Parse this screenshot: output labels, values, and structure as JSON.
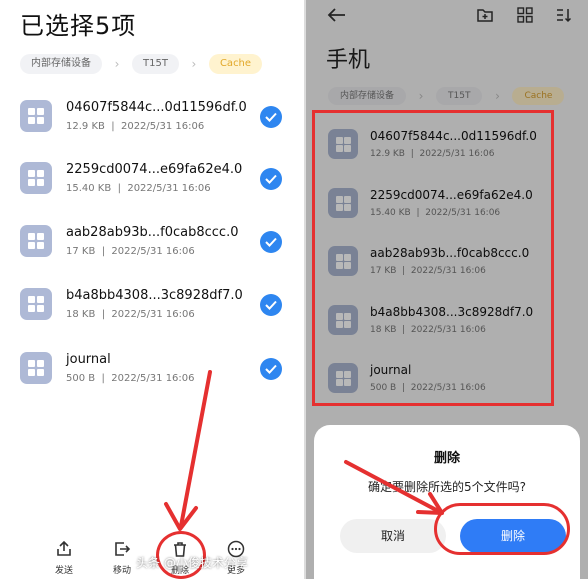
{
  "left": {
    "title": "已选择5项",
    "breadcrumbs": [
      "内部存储设备",
      "T15T",
      "Cache"
    ],
    "files": [
      {
        "name": "04607f5844c...0d11596df.0",
        "size": "12.9 KB",
        "date": "2022/5/31 16:06"
      },
      {
        "name": "2259cd0074...e69fa62e4.0",
        "size": "15.40 KB",
        "date": "2022/5/31 16:06"
      },
      {
        "name": "aab28ab93b...f0cab8ccc.0",
        "size": "17 KB",
        "date": "2022/5/31 16:06"
      },
      {
        "name": "b4a8bb4308...3c8928df7.0",
        "size": "18 KB",
        "date": "2022/5/31 16:06"
      },
      {
        "name": "journal",
        "size": "500 B",
        "date": "2022/5/31 16:06"
      }
    ],
    "actions": [
      "发送",
      "移动",
      "删除",
      "更多"
    ],
    "meta_separator": "|"
  },
  "right": {
    "title": "手机",
    "breadcrumbs": [
      "内部存储设备",
      "T15T",
      "Cache"
    ],
    "files": [
      {
        "name": "04607f5844c...0d11596df.0",
        "size": "12.9 KB",
        "date": "2022/5/31 16:06"
      },
      {
        "name": "2259cd0074...e69fa62e4.0",
        "size": "15.40 KB",
        "date": "2022/5/31 16:06"
      },
      {
        "name": "aab28ab93b...f0cab8ccc.0",
        "size": "17 KB",
        "date": "2022/5/31 16:06"
      },
      {
        "name": "b4a8bb4308...3c8928df7.0",
        "size": "18 KB",
        "date": "2022/5/31 16:06"
      },
      {
        "name": "journal",
        "size": "500 B",
        "date": "2022/5/31 16:06"
      }
    ],
    "toolbar_icons": [
      "back-arrow-icon",
      "new-folder-icon",
      "grid-view-icon",
      "sort-icon"
    ],
    "dialog": {
      "title": "删除",
      "message": "确定要删除所选的5个文件吗?",
      "cancel_label": "取消",
      "confirm_label": "删除"
    }
  },
  "watermark": "头条 @小俊技术分享",
  "colors": {
    "accent_blue": "#2e86f0",
    "annotation_red": "#e53030",
    "file_icon": "#aeb9d6",
    "cache_chip_text": "#e2a82a"
  }
}
